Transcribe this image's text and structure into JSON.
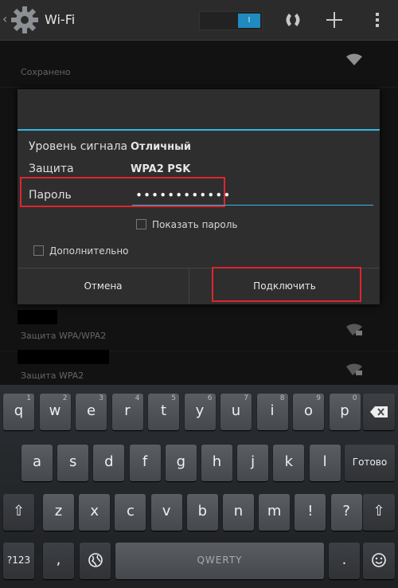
{
  "actionbar": {
    "title": "Wi-Fi",
    "toggle_state": "I",
    "icons": [
      "gear-icon",
      "wps-icon",
      "add-network-icon",
      "overflow-menu-icon"
    ]
  },
  "list": {
    "saved_label": "Сохранено",
    "rows": [
      {
        "security": "Защита WPA/WPA2"
      },
      {
        "security": "Защита WPA2"
      }
    ]
  },
  "dialog": {
    "signal_label": "Уровень сигнала",
    "signal_value": "Отличный",
    "security_label": "Защита",
    "security_value": "WPA2 PSK",
    "password_label": "Пароль",
    "password_value": "••••••••••••",
    "show_password_label": "Показать пароль",
    "advanced_label": "Дополнительно",
    "cancel_label": "Отмена",
    "connect_label": "Подключить"
  },
  "keyboard": {
    "row1": [
      {
        "k": "q",
        "h": "1"
      },
      {
        "k": "w",
        "h": "2"
      },
      {
        "k": "e",
        "h": "3"
      },
      {
        "k": "r",
        "h": "4"
      },
      {
        "k": "t",
        "h": "5"
      },
      {
        "k": "y",
        "h": "6"
      },
      {
        "k": "u",
        "h": "7"
      },
      {
        "k": "i",
        "h": "8"
      },
      {
        "k": "o",
        "h": "9"
      },
      {
        "k": "p",
        "h": "0"
      }
    ],
    "row2": [
      {
        "k": "a",
        "h": ""
      },
      {
        "k": "s",
        "h": ""
      },
      {
        "k": "d",
        "h": ""
      },
      {
        "k": "f",
        "h": ""
      },
      {
        "k": "g",
        "h": ""
      },
      {
        "k": "h",
        "h": ""
      },
      {
        "k": "j",
        "h": ""
      },
      {
        "k": "k",
        "h": ""
      },
      {
        "k": "l",
        "h": ""
      }
    ],
    "row3": [
      {
        "k": "z",
        "h": ""
      },
      {
        "k": "x",
        "h": ""
      },
      {
        "k": "c",
        "h": ""
      },
      {
        "k": "v",
        "h": ""
      },
      {
        "k": "b",
        "h": ""
      },
      {
        "k": "n",
        "h": ""
      },
      {
        "k": "m",
        "h": ""
      },
      {
        "k": "!",
        "h": ""
      },
      {
        "k": "?",
        "h": ""
      }
    ],
    "done_label": "Готово",
    "symbols_label": "?123",
    "comma_label": ",",
    "space_label": "QWERTY",
    "period_label": ".",
    "shift_label": "⇧"
  },
  "colors": {
    "accent": "#33b5e5",
    "highlight": "#e0242e"
  }
}
